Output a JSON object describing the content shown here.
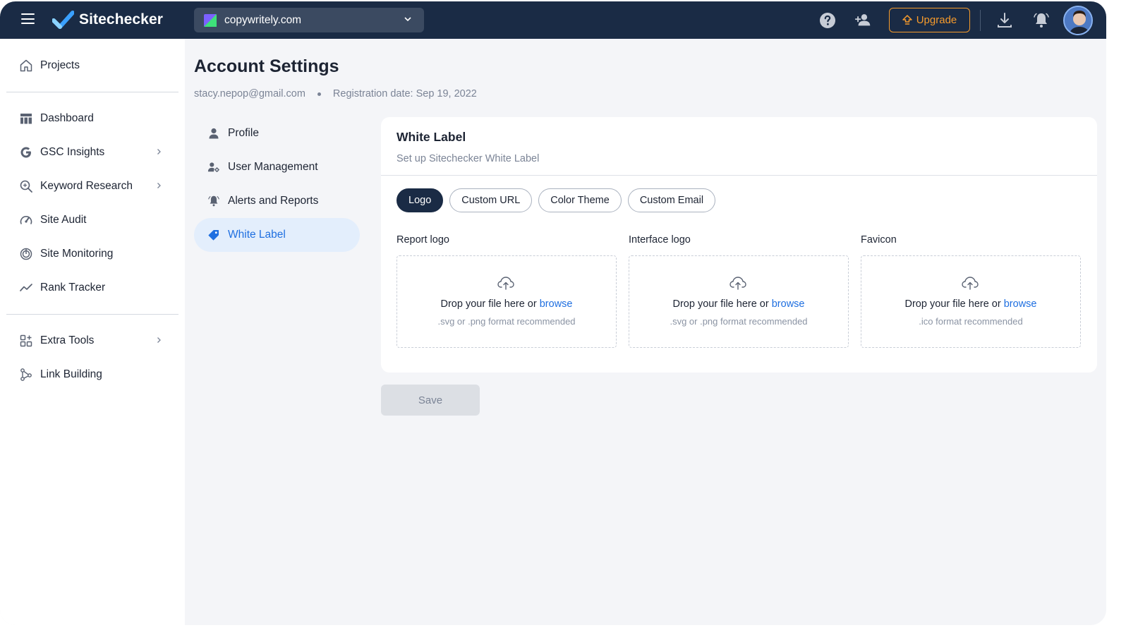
{
  "topbar": {
    "brand": "Sitechecker",
    "project": "copywritely.com",
    "upgrade_label": "Upgrade",
    "icons": [
      "menu-icon",
      "help-icon",
      "add-user-icon",
      "upgrade-arrow-icon",
      "download-icon",
      "bell-icon",
      "avatar"
    ]
  },
  "sidebar": {
    "items": [
      {
        "label": "Projects",
        "icon": "home-icon"
      },
      {
        "label": "Dashboard",
        "icon": "dashboard-icon"
      },
      {
        "label": "GSC Insights",
        "icon": "google-icon"
      },
      {
        "label": "Keyword Research",
        "icon": "keyword-search-icon"
      },
      {
        "label": "Site Audit",
        "icon": "gauge-icon"
      },
      {
        "label": "Site Monitoring",
        "icon": "monitoring-icon"
      },
      {
        "label": "Rank Tracker",
        "icon": "trend-icon"
      },
      {
        "label": "Extra Tools",
        "icon": "tools-grid-icon"
      },
      {
        "label": "Link Building",
        "icon": "link-network-icon"
      }
    ]
  },
  "page": {
    "title": "Account Settings",
    "email": "stacy.nepop@gmail.com",
    "registration": "Registration date: Sep 19, 2022"
  },
  "settings_nav": {
    "items": [
      {
        "label": "Profile",
        "icon": "user-icon"
      },
      {
        "label": "User Management",
        "icon": "user-gear-icon"
      },
      {
        "label": "Alerts and Reports",
        "icon": "bell-icon"
      },
      {
        "label": "White Label",
        "icon": "tag-icon",
        "active": true
      }
    ]
  },
  "white_label": {
    "title": "White Label",
    "subtitle": "Set up Sitechecker White Label",
    "tabs": [
      "Logo",
      "Custom URL",
      "Color Theme",
      "Custom Email"
    ],
    "active_tab": "Logo",
    "uploads": [
      {
        "label": "Report logo",
        "drop_text": "Drop your file here or",
        "link": "browse",
        "hint": ".svg or .png format recommended"
      },
      {
        "label": "Interface logo",
        "drop_text": "Drop your file here or",
        "link": "browse",
        "hint": ".svg or .png format recommended"
      },
      {
        "label": "Favicon",
        "drop_text": "Drop your file here or",
        "link": "browse",
        "hint": ".ico format recommended"
      }
    ],
    "save_label": "Save"
  },
  "colors": {
    "topbar": "#1a2b45",
    "accent": "#1f6fe0",
    "upgrade": "#f59a2c",
    "active_nav_bg": "#e3eefc"
  }
}
